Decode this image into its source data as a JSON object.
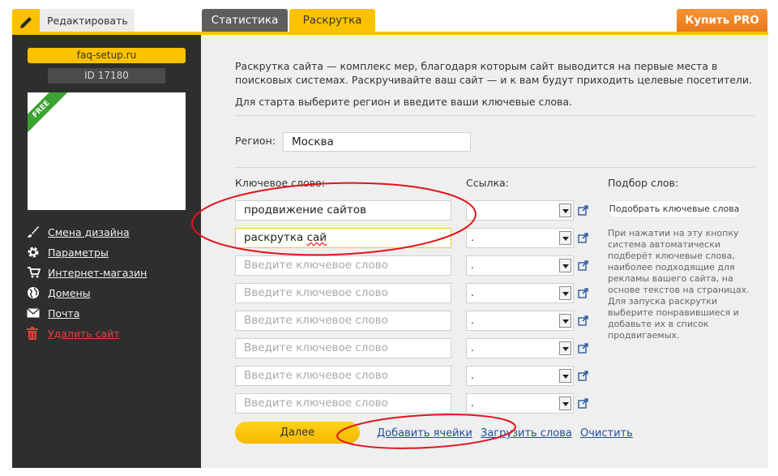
{
  "tabs": {
    "edit_label": "Редактировать",
    "stats_label": "Статистика",
    "promo_label": "Раскрутка",
    "buy_pro_label": "Купить PRO"
  },
  "sidebar": {
    "site_name": "faq-setup.ru",
    "site_id": "ID 17180",
    "free_badge": "FREE",
    "menu": [
      {
        "label": "Смена дизайна",
        "icon": "brush-icon"
      },
      {
        "label": "Параметры",
        "icon": "gear-icon"
      },
      {
        "label": "Интернет-магазин",
        "icon": "cart-icon"
      },
      {
        "label": "Домены",
        "icon": "globe-icon"
      },
      {
        "label": "Почта",
        "icon": "envelope-icon"
      },
      {
        "label": "Удалить сайт",
        "icon": "trash-icon"
      }
    ]
  },
  "main": {
    "intro": "Раскрутка сайта — комплекс мер, благодаря которым сайт выводится на первые места в поисковых системах. Раскручивайте ваш сайт — и к вам будут приходить целевые посетители.",
    "start_text": "Для старта выберите регион и введите ваши ключевые слова.",
    "region_label": "Регион:",
    "region_value": "Москва",
    "keyword_header": "Ключевое слово:",
    "link_header": "Ссылка:",
    "pick_header": "Подбор слов:",
    "pick_button": "Подобрать ключевые слова",
    "help_text": "При нажатии на эту кнопку система автоматически подберёт ключевые слова, наиболее подходящие для рекламы вашего сайта, на основе текстов на страницах. Для запуска раскрутки выберите понравившиеся и добавьте их в список продвигаемых.",
    "keyword_placeholder": "Введите ключевое слово",
    "rows": [
      {
        "keyword": "продвижение сайтов",
        "link": ""
      },
      {
        "keyword_a": "раскрутка ",
        "keyword_b": "сай",
        "link": "."
      },
      {
        "keyword": "",
        "link": "."
      },
      {
        "keyword": "",
        "link": "."
      },
      {
        "keyword": "",
        "link": "."
      },
      {
        "keyword": "",
        "link": "."
      },
      {
        "keyword": "",
        "link": "."
      },
      {
        "keyword": "",
        "link": "."
      }
    ],
    "next_button": "Далее",
    "add_cells_link": "Добавить ячейки",
    "load_words_link": "Загрузить слова",
    "clear_link": "Очистить"
  },
  "colors": {
    "accent_yellow": "#fcc200",
    "sidebar_bg": "#2e2e2e",
    "buy_orange": "#f08a2a",
    "annotation_red": "#e0141c",
    "link_blue": "#1d4f9c"
  }
}
